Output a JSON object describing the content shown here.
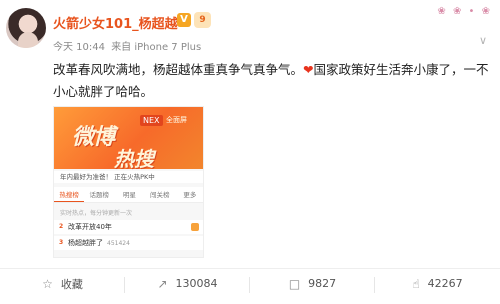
{
  "post": {
    "username": "火箭少女101_杨超越",
    "vip_badge": "V",
    "level_badge": "9",
    "time": "今天 10:44",
    "source": "来自 iPhone 7 Plus",
    "text_part1": "改革春风吹满地，杨超越体重真争气真争气。",
    "heart": "❤",
    "text_part2": "国家政策好生活奔小康了，一不小心就胖了哈哈。",
    "decor": "❀ ❀ • ❀"
  },
  "card": {
    "banner_big": "微博",
    "banner_big2": "热搜",
    "banner_tag": "NEX",
    "banner_tag2": "全面屏",
    "strip_text": "年内最好为准爸！ 正在火热PK中",
    "tabs": [
      "热搜榜",
      "话题榜",
      "明星",
      "闯关榜",
      "更多"
    ],
    "subhead": "实时热点，每分钟更新一次",
    "rows": [
      {
        "rank": "2",
        "title": "改革开放40年",
        "num": ""
      },
      {
        "rank": "3",
        "title": "杨超越胖了",
        "num": "451424"
      }
    ]
  },
  "actions": {
    "favorite": {
      "label": "收藏",
      "icon": "star-icon"
    },
    "repost": {
      "label": "130084",
      "icon": "repost-icon"
    },
    "comment": {
      "label": "9827",
      "icon": "comment-icon"
    },
    "like": {
      "label": "42267",
      "icon": "thumbs-up-icon"
    }
  }
}
